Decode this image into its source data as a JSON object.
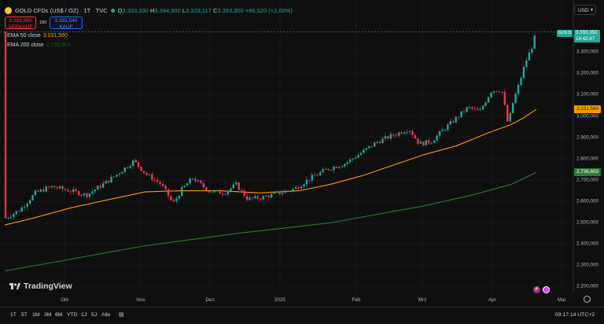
{
  "header": {
    "symbol": "GOLD CFDs (US$ / OZ) · 1T · TVC",
    "ohlc": [
      {
        "k": "O",
        "v": "3.333,330"
      },
      {
        "k": "H",
        "v": "3.394,900"
      },
      {
        "k": "L",
        "v": "3.329,117"
      },
      {
        "k": "C",
        "v": "3.393,350"
      }
    ],
    "change": "+66,520 (+2,00%)"
  },
  "trade": {
    "sell_price": "3.393,360",
    "sell_label": "VERKAUF",
    "spread": "180",
    "buy_price": "3.393,540",
    "buy_label": "KAUF"
  },
  "indicators": [
    {
      "name": "EMA 50 close",
      "value": "3.031,560",
      "color": "#ff9800"
    },
    {
      "name": "EMA 200 close",
      "value": "2.736,603",
      "color": "#1b5e20"
    }
  ],
  "currency": "USD",
  "price_scale": {
    "labels": [
      "3.300,000",
      "3.200,000",
      "3.100,000",
      "3.000,000",
      "2.900,000",
      "2.800,000",
      "2.700,000",
      "2.600,000",
      "2.500,000",
      "2.400,000",
      "2.300,000",
      "2.200,000"
    ],
    "gold_label": "GOLD",
    "last_price": "3.393,350",
    "countdown": "14:42:47",
    "ema50_label": "3.031,560",
    "ema200_label": "2.736,603"
  },
  "time_axis": [
    "Okt",
    "Nov",
    "Dez",
    "2025",
    "Feb",
    "Mrz",
    "Apr",
    "Mai"
  ],
  "branding": {
    "logo_text": "TradingView"
  },
  "toolbar": {
    "timeframes": [
      "1T",
      "5T",
      "1M",
      "3M",
      "6M",
      "YTD",
      "1J",
      "5J",
      "Alle"
    ],
    "time": "09:17:14 UTC+2"
  },
  "colors": {
    "up": "#26a69a",
    "down": "#f23645",
    "ema50": "#ff9800",
    "ema200": "#2e7d32",
    "bg": "#0f0f0f"
  },
  "chart_data": {
    "type": "candlestick",
    "x_axis": [
      "Okt",
      "Nov",
      "Dez",
      "2025",
      "Feb",
      "Mrz",
      "Apr",
      "Mai"
    ],
    "y_range": [
      2200,
      3400
    ],
    "series": [
      {
        "name": "EMA 50 close",
        "value_last": 3031.56
      },
      {
        "name": "EMA 200 close",
        "value_last": 2736.603
      }
    ],
    "last_close": 3393.35
  }
}
